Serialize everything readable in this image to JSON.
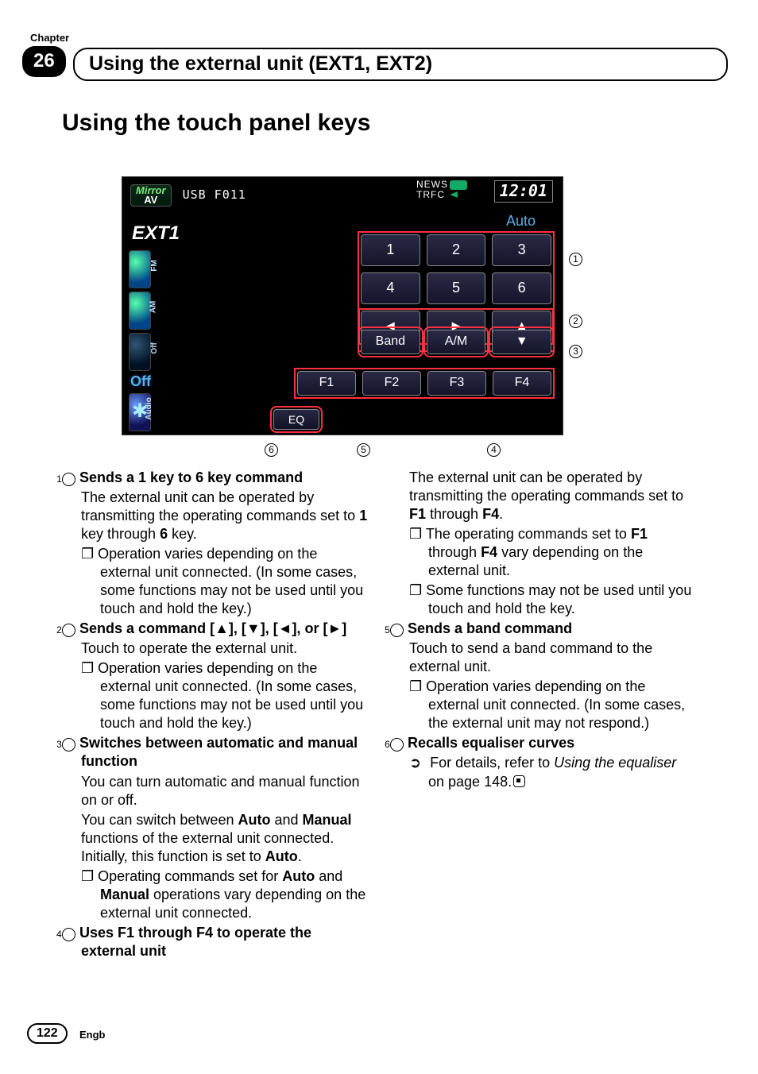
{
  "chapter": {
    "label": "Chapter",
    "number": "26",
    "title": "Using the external unit (EXT1, EXT2)"
  },
  "section_title": "Using the touch panel keys",
  "screen": {
    "mirror_line1": "Mirror",
    "mirror_line2": "AV",
    "source": "USB F011",
    "news": "NEWS",
    "trfc": "TRFC",
    "clock": "12:01",
    "mode": "Auto",
    "ext": "EXT1",
    "off": "Off",
    "eq": "EQ",
    "side": {
      "fm": "FM",
      "am": "AM",
      "off": "Off",
      "audio": "Audio"
    },
    "nums": [
      "1",
      "2",
      "3",
      "4",
      "5",
      "6"
    ],
    "arrows": [
      "◄",
      "►",
      "▲",
      "▼"
    ],
    "band": "Band",
    "am_btn": "A/M",
    "f": [
      "F1",
      "F2",
      "F3",
      "F4"
    ]
  },
  "callouts_right": {
    "c1": "1",
    "c2": "2",
    "c3": "3"
  },
  "callouts_below": {
    "c6": "6",
    "c5": "5",
    "c4": "4"
  },
  "items": {
    "i1": {
      "num": "1",
      "title": "Sends a 1 key to 6 key command",
      "p1a": "The external unit can be operated by transmitting the operating commands set to ",
      "b1": "1",
      "p1b": " key through ",
      "b2": "6",
      "p1c": " key.",
      "sub1": "❐  Operation varies depending on the external unit connected. (In some cases, some functions may not be used until you touch and hold the key.)"
    },
    "i2": {
      "num": "2",
      "title_a": "Sends a command ",
      "title_b": "[▲], [▼], [◄], or [►]",
      "p1": "Touch to operate the external unit.",
      "sub1": "❐  Operation varies depending on the external unit connected. (In some cases, some functions may not be used until you touch and hold the key.)"
    },
    "i3": {
      "num": "3",
      "title": "Switches between automatic and manual function",
      "p1": "You can turn automatic and manual function on or off.",
      "p2a": "You can switch between ",
      "b1": "Auto",
      "p2b": " and ",
      "b2": "Manual",
      "p2c": " functions of the external unit connected. Initially, this function is set to ",
      "b3": "Auto",
      "p2d": ".",
      "sub1a": "❐  Operating commands set for ",
      "sub1b1": "Auto",
      "sub1b": " and ",
      "sub1b2": "Manual",
      "sub1c": " operations vary depending on the external unit connected."
    },
    "i4": {
      "num": "4",
      "title": "Uses F1 through F4 to operate the external unit",
      "p1a": "The external unit can be operated by transmitting the operating commands set to ",
      "b1": "F1",
      "p1b": " through ",
      "b2": "F4",
      "p1c": ".",
      "sub1a": "❐  The operating commands set to ",
      "sub1b1": "F1",
      "sub1b": " through ",
      "sub1b2": "F4",
      "sub1c": " vary depending on the external unit.",
      "sub2": "❐  Some functions may not be used until you touch and hold the key."
    },
    "i5": {
      "num": "5",
      "title": "Sends a band command",
      "p1": "Touch to send a band command to the external unit.",
      "sub1": "❐  Operation varies depending on the external unit connected. (In some cases, the external unit may not respond.)"
    },
    "i6": {
      "num": "6",
      "title": "Recalls equaliser curves",
      "sub1a": "For details, refer to ",
      "sub1b": "Using the equaliser",
      "sub1c": " on page 148."
    }
  },
  "footer": {
    "page": "122",
    "lang": "Engb"
  }
}
